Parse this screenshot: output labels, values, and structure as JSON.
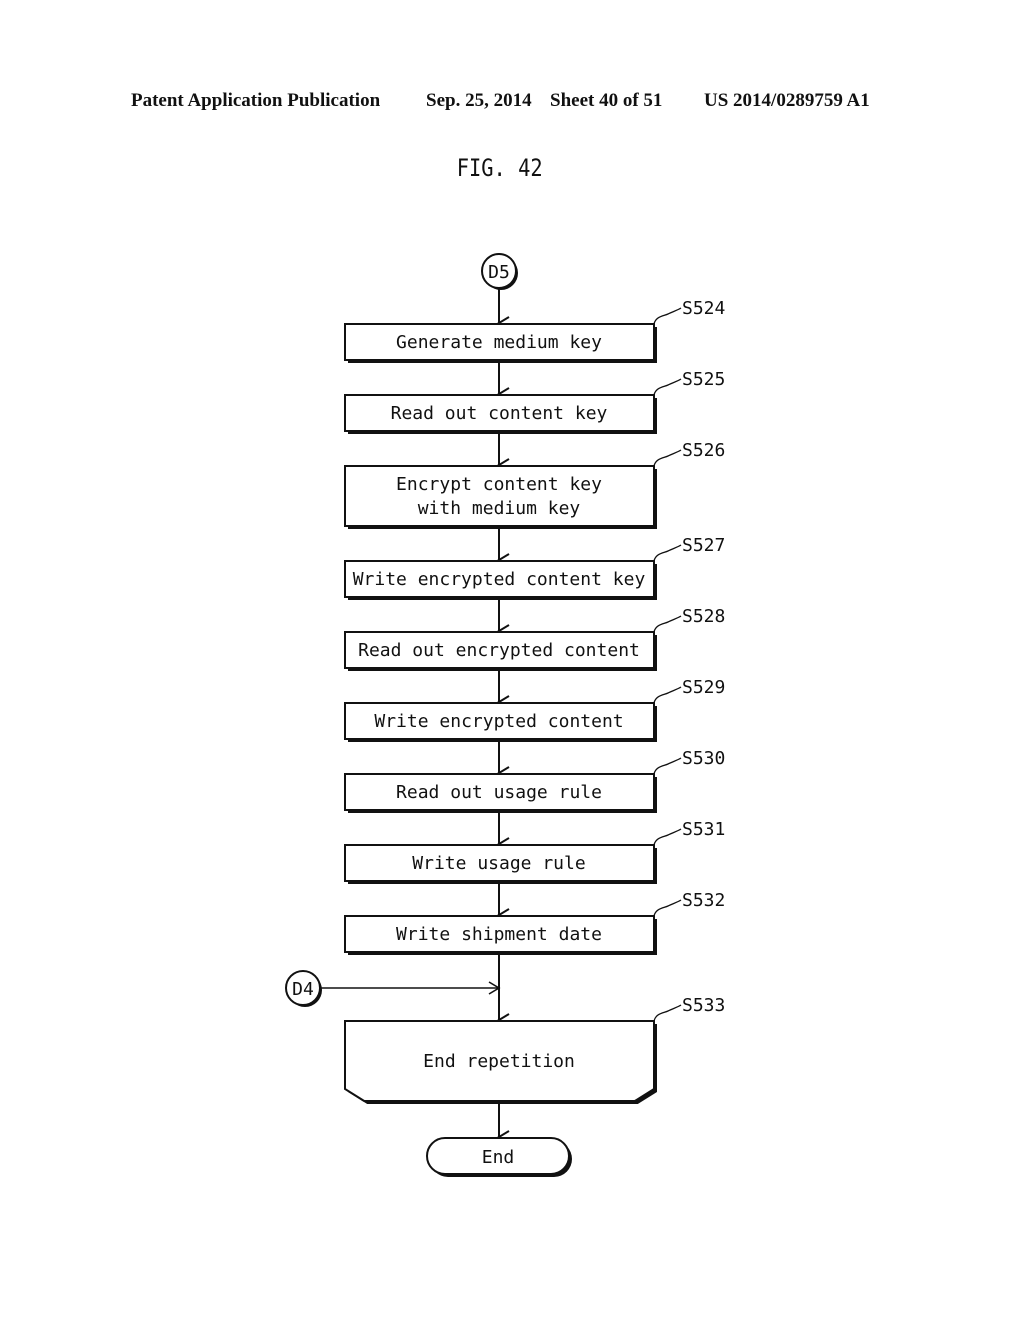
{
  "header": {
    "publication": "Patent Application Publication",
    "date": "Sep. 25, 2014",
    "sheet": "Sheet 40 of 51",
    "number": "US 2014/0289759 A1"
  },
  "figure": {
    "title": "FIG. 42"
  },
  "connectors": {
    "top": "D5",
    "side": "D4"
  },
  "steps": [
    {
      "id": "S524",
      "lines": [
        "Generate medium key"
      ]
    },
    {
      "id": "S525",
      "lines": [
        "Read out content key"
      ]
    },
    {
      "id": "S526",
      "lines": [
        "Encrypt content key",
        "with medium key"
      ]
    },
    {
      "id": "S527",
      "lines": [
        "Write encrypted content key"
      ]
    },
    {
      "id": "S528",
      "lines": [
        "Read out encrypted content"
      ]
    },
    {
      "id": "S529",
      "lines": [
        "Write encrypted content"
      ]
    },
    {
      "id": "S530",
      "lines": [
        "Read out usage rule"
      ]
    },
    {
      "id": "S531",
      "lines": [
        "Write usage rule"
      ]
    },
    {
      "id": "S532",
      "lines": [
        "Write shipment date"
      ]
    },
    {
      "id": "S533",
      "lines": [
        "End repetition"
      ]
    }
  ],
  "terminator": "End"
}
